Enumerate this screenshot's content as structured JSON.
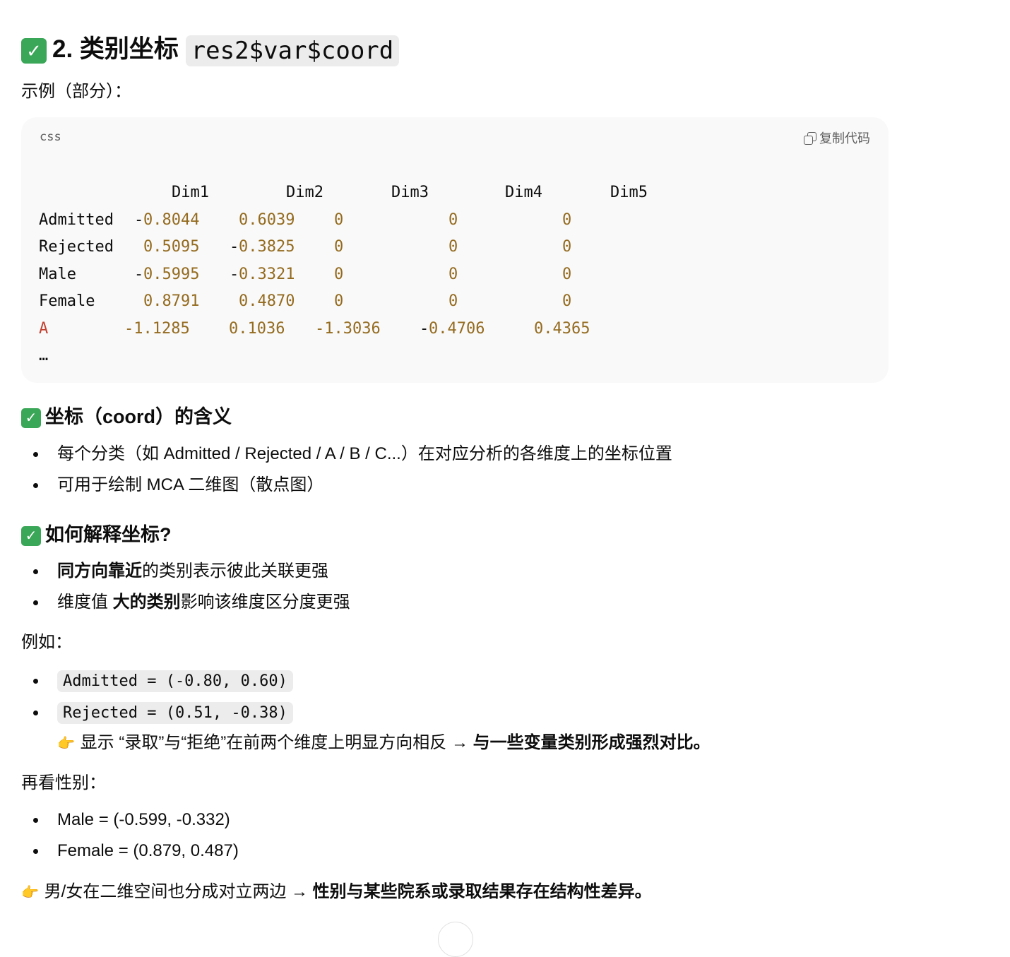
{
  "heading": {
    "check": "✓",
    "title": "2. 类别坐标",
    "code": "res2$var$coord"
  },
  "intro": "示例（部分）：",
  "codeblock": {
    "lang": "css",
    "copy_label": "复制代码",
    "header": [
      "Dim1",
      "Dim2",
      "Dim3",
      "Dim4",
      "Dim5"
    ],
    "rows": [
      {
        "label": "Admitted",
        "s1": "-",
        "v1": "0.8044",
        "s2": "",
        "v2": "0.6039",
        "v3": "0",
        "v4": "0",
        "v5": "0"
      },
      {
        "label": "Rejected",
        "s1": "",
        "v1": "0.5095",
        "s2": "-",
        "v2": "0.3825",
        "v3": "0",
        "v4": "0",
        "v5": "0"
      },
      {
        "label": "Male",
        "s1": "-",
        "v1": "0.5995",
        "s2": "-",
        "v2": "0.3321",
        "v3": "0",
        "v4": "0",
        "v5": "0"
      },
      {
        "label": "Female",
        "s1": "",
        "v1": "0.8791",
        "s2": "",
        "v2": "0.4870",
        "v3": "0",
        "v4": "0",
        "v5": "0"
      }
    ],
    "rowA": {
      "label": "A",
      "v1": "-1.1285",
      "v2": "0.1036",
      "v3": "-1.3036",
      "v4s": "-",
      "v4": "0.4706",
      "v5": "0.4365"
    },
    "ellipsis": "…"
  },
  "section_coord": {
    "title": "坐标（coord）的含义",
    "items": [
      "每个分类（如 Admitted / Rejected / A / B / C...）在对应分析的各维度上的坐标位置",
      "可用于绘制 MCA 二维图（散点图）"
    ]
  },
  "section_interpret": {
    "title": "如何解释坐标?",
    "item1_bold": "同方向靠近",
    "item1_rest": "的类别表示彼此关联更强",
    "item2_pre": "维度值 ",
    "item2_bold": "大的类别",
    "item2_rest": "影响该维度区分度更强"
  },
  "example_label": "例如：",
  "examples": [
    "Admitted = (-0.80, 0.60)",
    "Rejected = (0.51, -0.38)"
  ],
  "example_note": {
    "hand": "👉",
    "text": " 显示 “录取”与“拒绝”在前两个维度上明显方向相反 → ",
    "bold": "与一些变量类别形成强烈对比。"
  },
  "gender_label": "再看性别：",
  "gender_items": [
    "Male = (-0.599, -0.332)",
    "Female = (0.879, 0.487)"
  ],
  "conclusion": {
    "hand": "👉",
    "text": " 男/女在二维空间也分成对立两边 → ",
    "bold": "性别与某些院系或录取结果存在结构性差异。"
  }
}
